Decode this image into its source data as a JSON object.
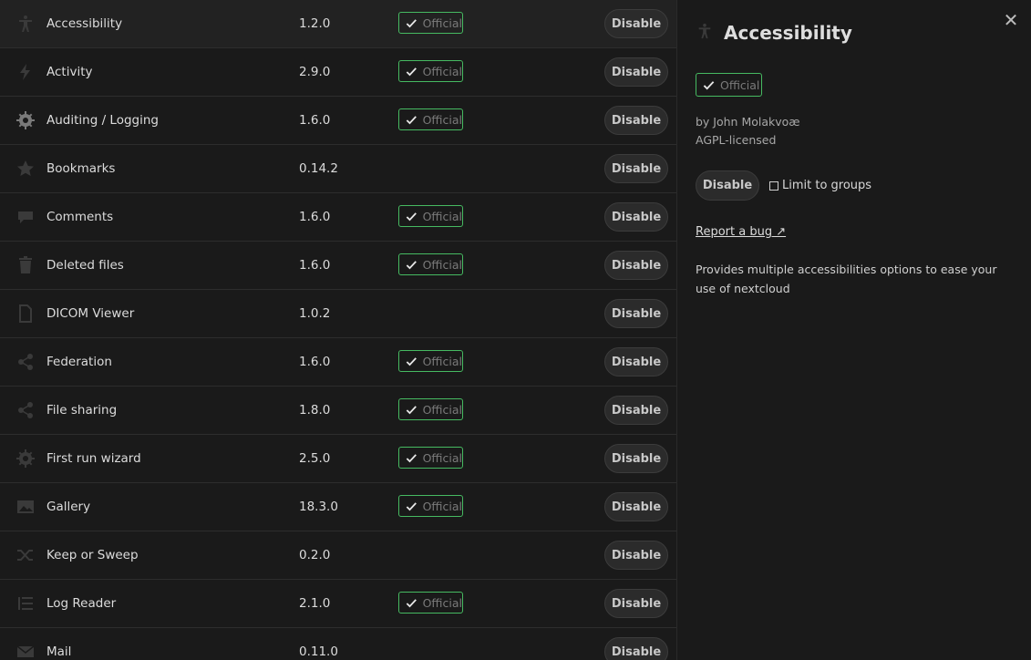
{
  "apps": [
    {
      "name": "Accessibility",
      "version": "1.2.0",
      "official": true,
      "action": "Disable",
      "icon": "accessibility-icon"
    },
    {
      "name": "Activity",
      "version": "2.9.0",
      "official": true,
      "action": "Disable",
      "icon": "activity-icon"
    },
    {
      "name": "Auditing / Logging",
      "version": "1.6.0",
      "official": true,
      "action": "Disable",
      "icon": "gear-icon"
    },
    {
      "name": "Bookmarks",
      "version": "0.14.2",
      "official": false,
      "action": "Disable",
      "icon": "star-icon"
    },
    {
      "name": "Comments",
      "version": "1.6.0",
      "official": true,
      "action": "Disable",
      "icon": "comment-icon"
    },
    {
      "name": "Deleted files",
      "version": "1.6.0",
      "official": true,
      "action": "Disable",
      "icon": "trash-icon"
    },
    {
      "name": "DICOM Viewer",
      "version": "1.0.2",
      "official": false,
      "action": "Disable",
      "icon": "file-icon"
    },
    {
      "name": "Federation",
      "version": "1.6.0",
      "official": true,
      "action": "Disable",
      "icon": "share-icon"
    },
    {
      "name": "File sharing",
      "version": "1.8.0",
      "official": true,
      "action": "Disable",
      "icon": "share-icon"
    },
    {
      "name": "First run wizard",
      "version": "2.5.0",
      "official": true,
      "action": "Disable",
      "icon": "gear-icon"
    },
    {
      "name": "Gallery",
      "version": "18.3.0",
      "official": true,
      "action": "Disable",
      "icon": "image-icon"
    },
    {
      "name": "Keep or Sweep",
      "version": "0.2.0",
      "official": false,
      "action": "Disable",
      "icon": "shuffle-icon"
    },
    {
      "name": "Log Reader",
      "version": "2.1.0",
      "official": true,
      "action": "Disable",
      "icon": "list-icon"
    },
    {
      "name": "Mail",
      "version": "0.11.0",
      "official": false,
      "action": "Disable",
      "icon": "mail-icon"
    }
  ],
  "badge_label": "Official",
  "detail": {
    "title": "Accessibility",
    "badge": "Official",
    "author": "by John Molakvoæ",
    "license": "AGPL-licensed",
    "disable_label": "Disable",
    "limit_label": "Limit to groups",
    "report_label": "Report a bug ↗",
    "description": "Provides multiple accessibilities options to ease your use of nextcloud",
    "close_glyph": "✕"
  },
  "colors": {
    "accent": "#c0144a",
    "official_border": "#46ba61",
    "background": "#1a1a1a"
  }
}
